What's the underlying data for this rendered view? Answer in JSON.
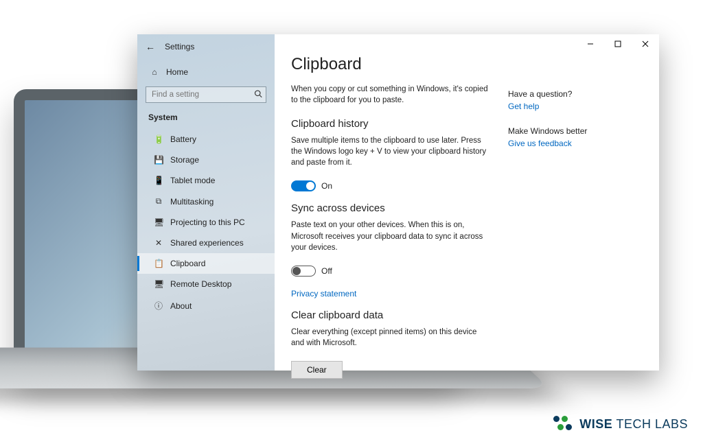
{
  "app": {
    "title": "Settings"
  },
  "sidebar": {
    "home_label": "Home",
    "search_placeholder": "Find a setting",
    "category": "System",
    "items": [
      {
        "icon": "🔋",
        "label": "Battery"
      },
      {
        "icon": "💾",
        "label": "Storage"
      },
      {
        "icon": "📱",
        "label": "Tablet mode"
      },
      {
        "icon": "⧉",
        "label": "Multitasking"
      },
      {
        "icon": "🖥",
        "label": "Projecting to this PC"
      },
      {
        "icon": "✕",
        "label": "Shared experiences"
      },
      {
        "icon": "📋",
        "label": "Clipboard"
      },
      {
        "icon": "🖥",
        "label": "Remote Desktop"
      },
      {
        "icon": "ⓘ",
        "label": "About"
      }
    ],
    "active_index": 6
  },
  "page": {
    "title": "Clipboard",
    "intro": "When you copy or cut something in Windows, it's copied to the clipboard for you to paste.",
    "history": {
      "heading": "Clipboard history",
      "desc": "Save multiple items to the clipboard to use later. Press the Windows logo key + V to view your clipboard history and paste from it.",
      "state_label": "On",
      "state": true
    },
    "sync": {
      "heading": "Sync across devices",
      "desc": "Paste text on your other devices. When this is on, Microsoft receives your clipboard data to sync it across your devices.",
      "state_label": "Off",
      "state": false,
      "privacy_link": "Privacy statement"
    },
    "clear": {
      "heading": "Clear clipboard data",
      "desc": "Clear everything (except pinned items) on this device and with Microsoft.",
      "button": "Clear"
    }
  },
  "side_panel": {
    "question_heading": "Have a question?",
    "help_link": "Get help",
    "improve_heading": "Make Windows better",
    "feedback_link": "Give us feedback"
  },
  "brand": {
    "text_bold": "WISE",
    "text_rest": " TECH LABS"
  }
}
